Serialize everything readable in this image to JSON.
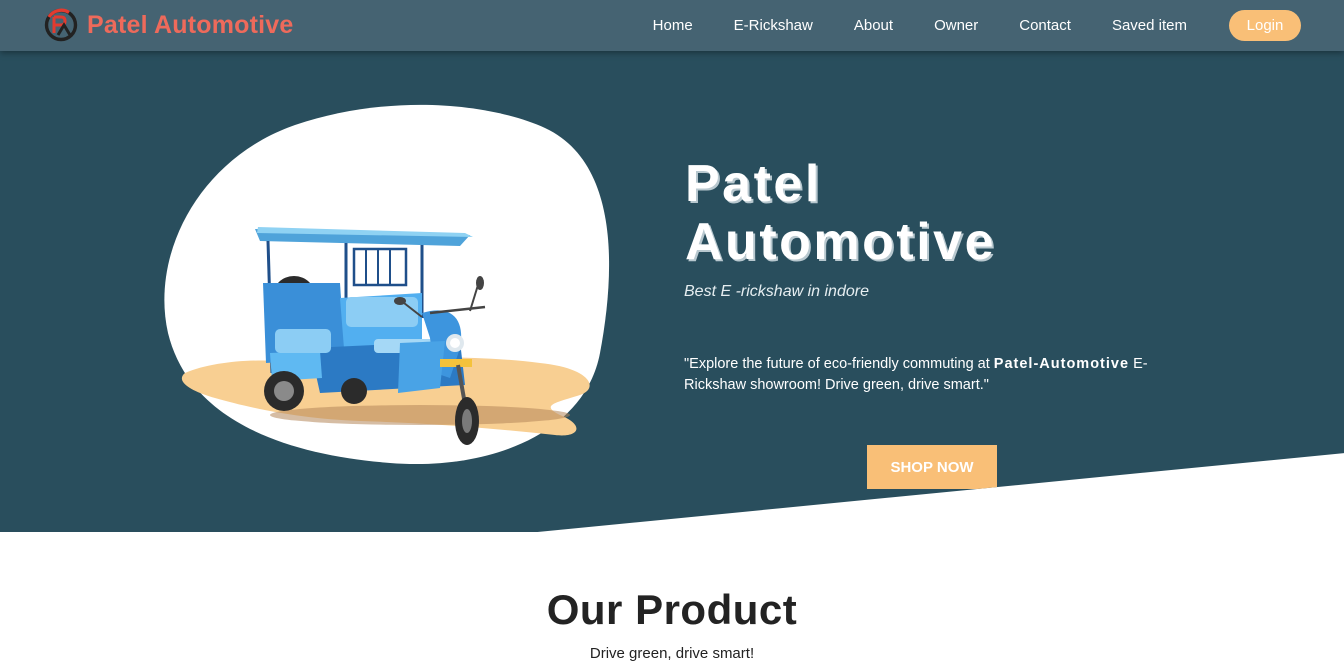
{
  "brand": {
    "name": "Patel Automotive",
    "logo_icon": "pa-monogram-icon",
    "color": "#ee6a5b"
  },
  "nav": {
    "items": [
      {
        "label": "Home"
      },
      {
        "label": "E-Rickshaw"
      },
      {
        "label": "About"
      },
      {
        "label": "Owner"
      },
      {
        "label": "Contact"
      },
      {
        "label": "Saved item"
      }
    ],
    "login_label": "Login"
  },
  "hero": {
    "title_line1": "Patel",
    "title_line2": "Automotive",
    "subtitle": "Best E -rickshaw in indore",
    "desc_prefix": "\"Explore the future of eco-friendly commuting at ",
    "desc_brand": "Patel-Automotive",
    "desc_suffix": " E-Rickshaw showroom! Drive green, drive smart.\"",
    "cta_label": "SHOP NOW",
    "image_icon": "e-rickshaw-illustration"
  },
  "products": {
    "title": "Our Product",
    "subtitle": "Drive green, drive smart!"
  },
  "colors": {
    "navbar": "#456372",
    "hero_bg": "#294e5d",
    "accent": "#f9bf77",
    "brand": "#ee6a5b"
  }
}
